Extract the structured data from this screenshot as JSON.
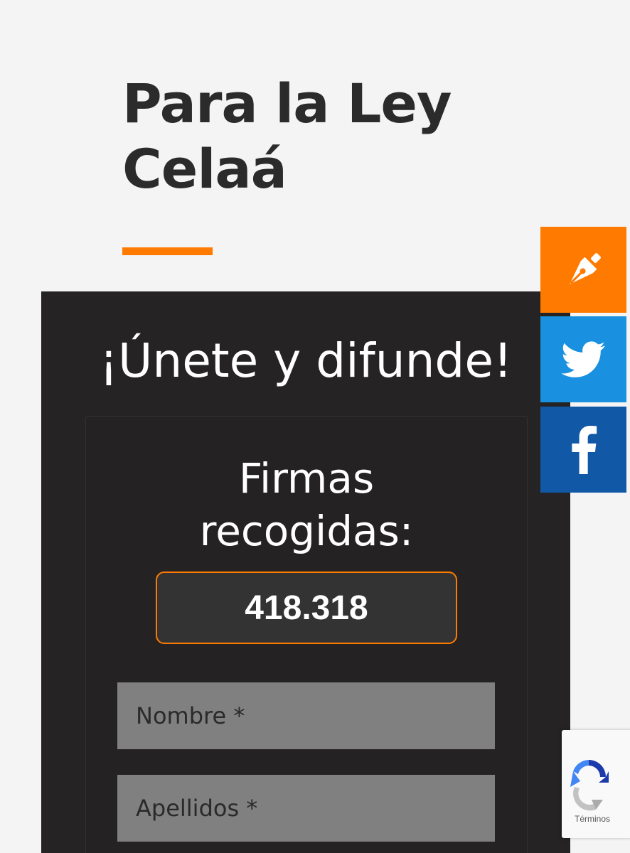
{
  "hero": {
    "title_line1": "Para la Ley",
    "title_line2": "Celaá"
  },
  "panel": {
    "heading": "¡Únete y difunde!",
    "counter_label_line1": "Firmas",
    "counter_label_line2": "recogidas:",
    "counter_value": "418.318"
  },
  "form": {
    "name_placeholder": "Nombre *",
    "surname_placeholder": "Apellidos *"
  },
  "share": {
    "sign_icon": "pen-nib-icon",
    "twitter_icon": "twitter-icon",
    "facebook_icon": "facebook-icon"
  },
  "recaptcha": {
    "terms_label": "Términos"
  },
  "colors": {
    "accent": "#ff7a00",
    "twitter": "#1a90e0",
    "facebook": "#1158a6",
    "panel_bg": "#252324",
    "page_bg": "#f4f4f4"
  }
}
